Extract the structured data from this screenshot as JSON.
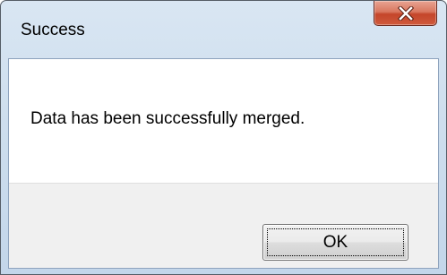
{
  "window": {
    "title": "Success",
    "close_icon": "close-x-icon"
  },
  "dialog": {
    "message": "Data has been successfully merged.",
    "ok_label": "OK"
  },
  "colors": {
    "close_button": "#c4452a",
    "frame": "#cfdfee",
    "button_area": "#f0f0f0"
  }
}
